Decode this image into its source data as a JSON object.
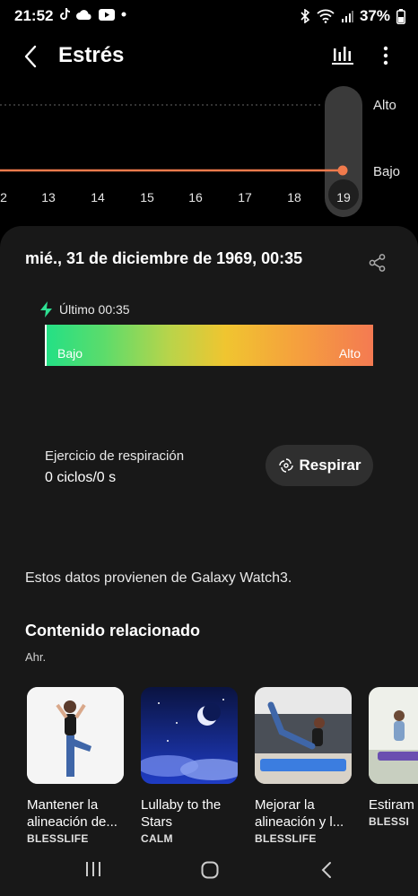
{
  "status_bar": {
    "time": "21:52",
    "battery": "37%"
  },
  "header": {
    "title": "Estrés",
    "back_icon": "back-arrow-icon",
    "chart_icon": "bar-chart-icon",
    "more_icon": "more-vertical-icon"
  },
  "chart": {
    "y_labels": {
      "high": "Alto",
      "low": "Bajo"
    },
    "x_ticks": [
      "2",
      "13",
      "14",
      "15",
      "16",
      "17",
      "18",
      "19"
    ],
    "selected": "19",
    "line_color": "#f07a4c"
  },
  "detail": {
    "date": "mié., 31 de diciembre de 1969, 00:35",
    "latest": "Último 00:35",
    "scale_low": "Bajo",
    "scale_high": "Alto",
    "breathing_title": "Ejercicio de respiración",
    "breathing_value": "0 ciclos/0 s",
    "breathe_button": "Respirar",
    "source_note": "Estos datos provienen de Galaxy Watch3.",
    "related_title": "Contenido relacionado",
    "related_sub": "Ahr."
  },
  "related_items": [
    {
      "title": "Mantener la alineación de...",
      "brand": "BLESSLIFE"
    },
    {
      "title": "Lullaby to the Stars",
      "brand": "CALM"
    },
    {
      "title": "Mejorar la alineación y l...",
      "brand": "BLESSLIFE"
    },
    {
      "title": "Estiram de todo",
      "brand": "BLESSI"
    }
  ],
  "colors": {
    "accent_line": "#f07a4c",
    "gradient_start": "#22e086",
    "gradient_end": "#f47a52"
  }
}
